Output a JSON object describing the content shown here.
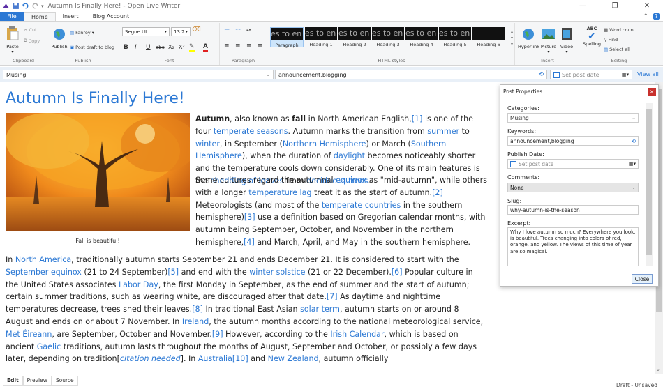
{
  "window": {
    "title": "Autumn Is Finally Here! - Open Live Writer"
  },
  "tabs": {
    "file": "File",
    "home": "Home",
    "insert": "Insert",
    "blog_account": "Blog Account"
  },
  "ribbon": {
    "clipboard": {
      "paste": "Paste",
      "cut": "Cut",
      "copy": "Copy",
      "label": "Clipboard"
    },
    "publish": {
      "publish": "Publish",
      "fanrey": "Fanrey",
      "draft": "Post draft to blog",
      "label": "Publish"
    },
    "font": {
      "family": "Segoe UI",
      "size": "13.2",
      "label": "Font"
    },
    "paragraph": {
      "label": "Paragraph"
    },
    "styles": {
      "label": "HTML styles",
      "items": [
        "Paragraph",
        "Heading 1",
        "Heading 2",
        "Heading 3",
        "Heading 4",
        "Heading 5",
        "Heading 6"
      ],
      "preview": "es to en"
    },
    "insert": {
      "hyperlink": "Hyperlink",
      "picture": "Picture",
      "video": "Video",
      "label": "Insert"
    },
    "editing": {
      "spelling": "Spelling",
      "word_count": "Word count",
      "find": "Find",
      "select_all": "Select all",
      "label": "Editing"
    }
  },
  "propbar": {
    "category": "Musing",
    "keywords": "announcement,blogging",
    "date_placeholder": "Set post date",
    "view_all": "View all"
  },
  "post": {
    "title": "Autumn Is Finally Here!",
    "caption": "Fall is beautiful!"
  },
  "panel": {
    "title": "Post Properties",
    "categories_label": "Categories:",
    "categories": "Musing",
    "keywords_label": "Keywords:",
    "keywords": "announcement,blogging",
    "date_label": "Publish Date:",
    "date_placeholder": "Set post date",
    "comments_label": "Comments:",
    "comments": "None",
    "slug_label": "Slug:",
    "slug": "why-autumn-is-the-season",
    "excerpt_label": "Excerpt:",
    "excerpt": "Why I love autumn so much? Everywhere you look, is beautiful. Trees changing into colors of red, orange, and yellow. The views of this time of year are so magical.",
    "close": "Close"
  },
  "views": {
    "edit": "Edit",
    "preview": "Preview",
    "source": "Source"
  },
  "status": "Draft - Unsaved",
  "colors": {
    "accent": "#2b78d4",
    "title_blue": "#2b78d4"
  }
}
